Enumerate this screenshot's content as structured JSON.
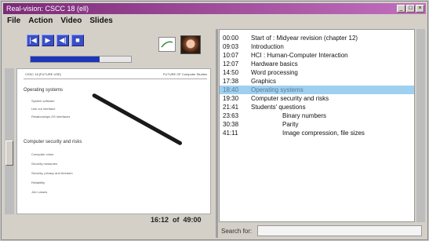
{
  "window": {
    "title": "Real-vision: CSCC 18 (ell)",
    "buttons": [
      "_",
      "□",
      "×"
    ]
  },
  "menu": {
    "items": [
      "File",
      "Action",
      "Video",
      "Slides"
    ]
  },
  "player": {
    "controls": [
      "|◀",
      "▶",
      "◀|",
      "■"
    ],
    "progress": 0.69,
    "time_readout": "16:12  of  49:00"
  },
  "slide": {
    "header_left": "CSSC 18 (FUTURE USE)",
    "header_right": "FUTURE OF Computer Studies",
    "heading1": "Operating systems",
    "bullets1": [
      "System software",
      "Use our interface",
      "Relationships OS interfaces"
    ],
    "heading2": "Computer security and risks",
    "bullets2": [
      "Computer crime",
      "Security measures",
      "Security, privacy and freedom",
      "Reliability",
      "Job Losses"
    ]
  },
  "toc": [
    {
      "time": "00:00",
      "title": "Start of : Midyear revision (chapter 12)"
    },
    {
      "time": "09:03",
      "title": "Introduction"
    },
    {
      "time": "10:07",
      "title": "HCI : Human-Computer Interaction"
    },
    {
      "time": "12:07",
      "title": "Hardware basics"
    },
    {
      "time": "14:50",
      "title": "Word processing"
    },
    {
      "time": "17:38",
      "title": "Graphics"
    },
    {
      "time": "18:40",
      "title": "Operating systems",
      "selected": true
    },
    {
      "time": "19:30",
      "title": "Computer security and risks"
    },
    {
      "time": "21:41",
      "title": "Students' questions"
    },
    {
      "time": "23:63",
      "title": "Binary numbers",
      "indent": true
    },
    {
      "time": "30:38",
      "title": "Parity",
      "indent": true
    },
    {
      "time": "41:11",
      "title": "Image compression, file sizes",
      "indent": true
    }
  ],
  "search": {
    "label": "Search for:",
    "value": ""
  }
}
